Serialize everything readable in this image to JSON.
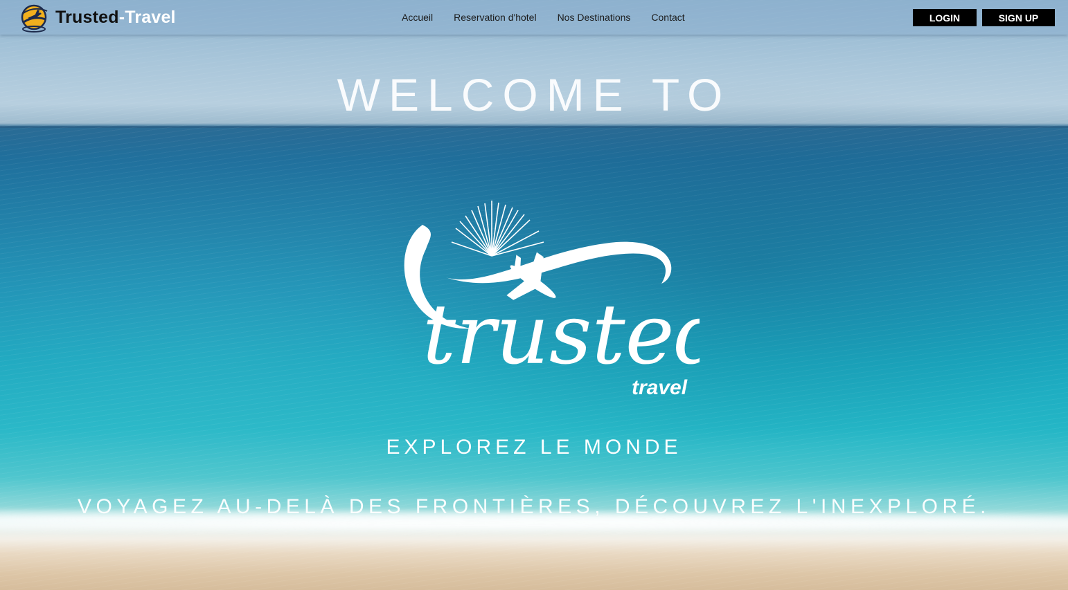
{
  "navbar": {
    "brand_part1": "Trusted",
    "brand_part2": "-Travel",
    "logo_icon": "globe-airplane-icon",
    "links": [
      "Accueil",
      "Reservation d'hotel",
      "Nos Destinations",
      "Contact"
    ],
    "login_label": "LOGIN",
    "signup_label": "SIGN UP"
  },
  "hero": {
    "welcome": "WELCOME TO",
    "logo_word": "trusted",
    "logo_sub": "travel",
    "tagline": "EXPLOREZ LE MONDE",
    "subtagline": "VOYAGEZ AU-DELÀ DES FRONTIÈRES, DÉCOUVREZ L'INEXPLORÉ."
  }
}
